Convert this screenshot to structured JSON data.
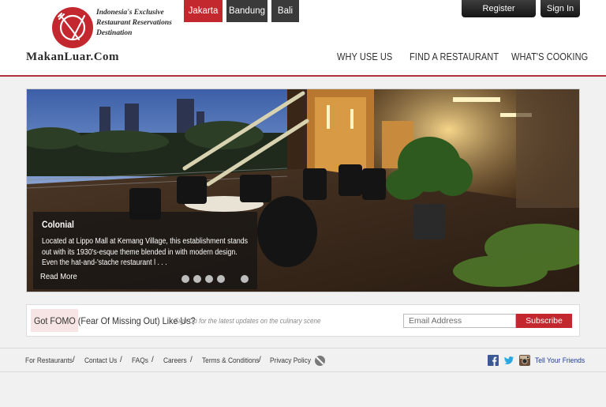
{
  "logo": {
    "tagline_line1": "Indonesia's Exclusive",
    "tagline_line2": "Restaurant Reservations",
    "tagline_line3": "Destination",
    "brand": "MakanLuar.Com",
    "brand_color": "#c4282f"
  },
  "city_tabs": [
    {
      "label": "Jakarta",
      "active": true
    },
    {
      "label": "Bandung",
      "active": false
    },
    {
      "label": "Bali",
      "active": false
    }
  ],
  "account": {
    "register_label": "Register",
    "signin_label": "Sign In"
  },
  "nav": {
    "why_use_us": "WHY USE US",
    "find_restaurant": "FIND A RESTAURANT",
    "whats_cooking": "WHAT'S COOKING"
  },
  "hero": {
    "title": "Colonial",
    "description": "Located at Lippo Mall at Kemang Village, this establishment stands out with its 1930's-esque theme blended in with modern design. Even the hat-and-'stache restaurant l . . .",
    "read_more": "Read More",
    "slide_count": 5,
    "active_slide": 5
  },
  "subscribe": {
    "title": "Got FOMO (Fear Of Missing Out) Like Us?",
    "subtitle": "Sign Up for the latest updates on the culinary scene",
    "email_placeholder": "Email Address",
    "button_label": "Subscribe"
  },
  "footer": {
    "links": [
      "For Restaurants",
      "Contact Us",
      "FAQs",
      "Careers",
      "Terms & Conditions",
      "Privacy Policy"
    ],
    "separator": "/",
    "social_icons": [
      "facebook-icon",
      "twitter-icon",
      "instagram-icon"
    ],
    "tell_friends": "Tell Your Friends"
  },
  "colors": {
    "accent_red": "#c4282f",
    "dark_button": "#2a2a2a",
    "link_blue": "#1f3d99"
  }
}
